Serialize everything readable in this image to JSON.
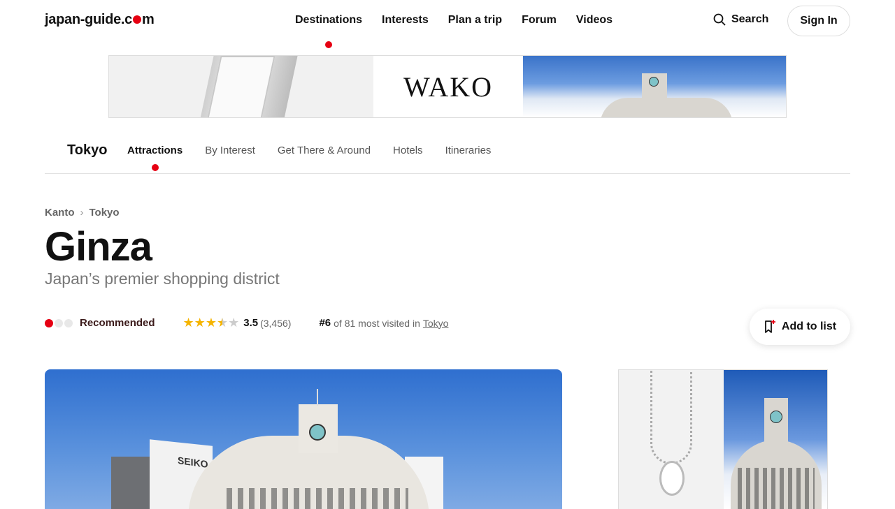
{
  "header": {
    "logo_prefix": "japan-guide.c",
    "logo_suffix": "m",
    "nav": [
      "Destinations",
      "Interests",
      "Plan a trip",
      "Forum",
      "Videos"
    ],
    "search_label": "Search",
    "signin_label": "Sign In"
  },
  "ad_banner": {
    "brand": "WAKO"
  },
  "subnav": {
    "city": "Tokyo",
    "tabs": [
      "Attractions",
      "By Interest",
      "Get There & Around",
      "Hotels",
      "Itineraries"
    ]
  },
  "breadcrumb": [
    "Kanto",
    "Tokyo"
  ],
  "page": {
    "title": "Ginza",
    "subtitle": "Japan’s premier shopping district"
  },
  "meta": {
    "recommendation_level": 1,
    "recommendation_max": 3,
    "recommendation_label": "Recommended",
    "rating_value": "3.5",
    "rating_stars": 3.5,
    "rating_count": "(3,456)",
    "rank": "#6",
    "rank_text": "of 81 most visited in",
    "rank_link": "Tokyo"
  },
  "add_to_list_label": "Add to list",
  "colors": {
    "accent": "#e60012",
    "star": "#f5b400"
  }
}
